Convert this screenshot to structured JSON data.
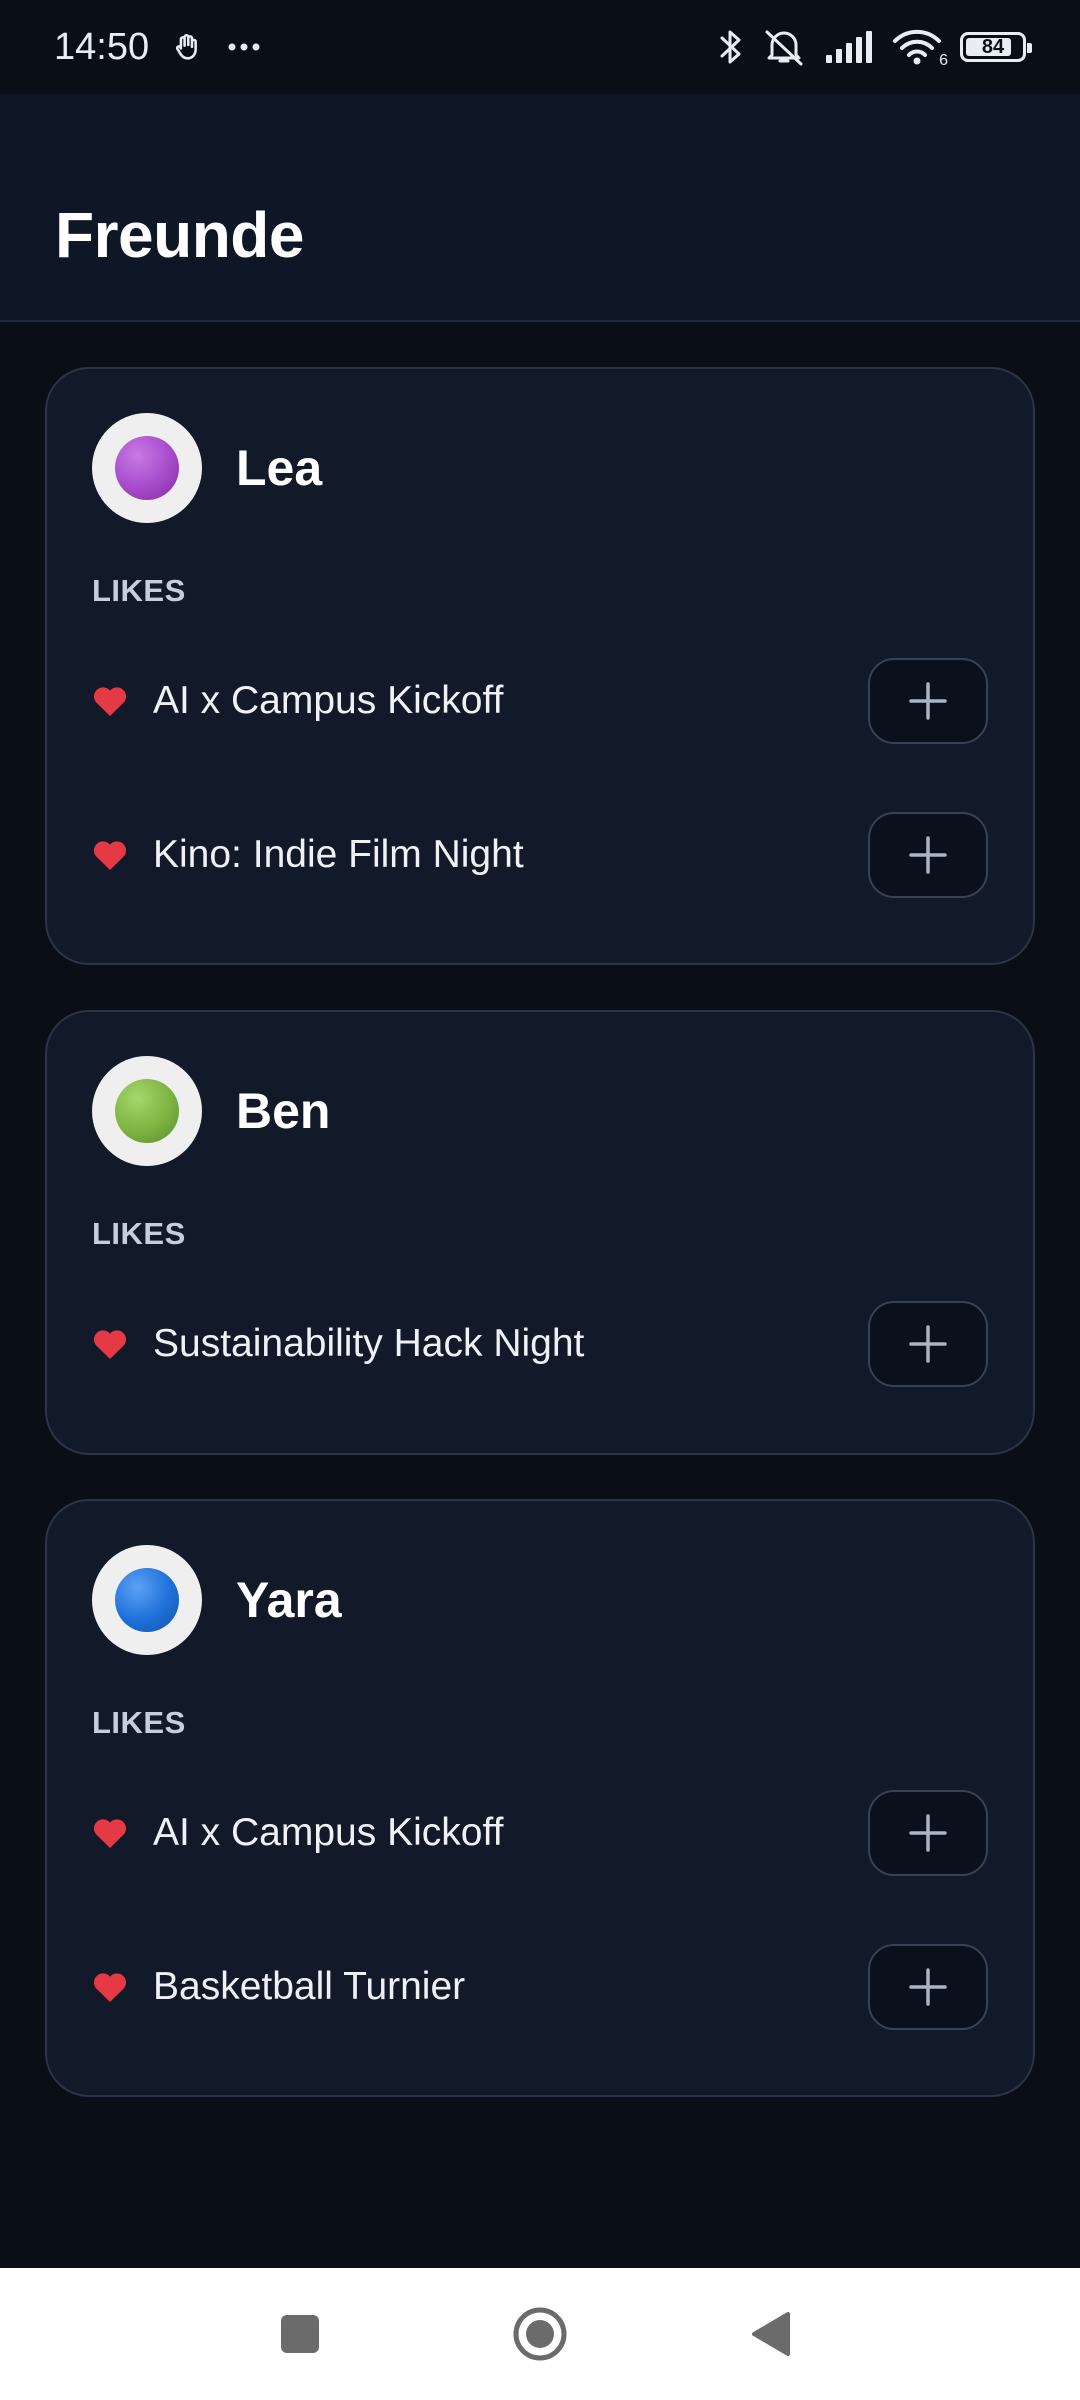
{
  "status_bar": {
    "time": "14:50",
    "notification_icons": [
      "hand-icon",
      "more-dots-icon"
    ],
    "system_icons": [
      "bluetooth-icon",
      "mute-icon",
      "signal-icon",
      "wifi-icon"
    ],
    "wifi_label": "6",
    "battery_level": "84",
    "battery_fraction": 0.84
  },
  "header": {
    "title": "Freunde"
  },
  "likes_label": "LIKES",
  "colors": {
    "heart": "#e63946",
    "lea_dot": "#a64ac9",
    "ben_dot": "#7cb342",
    "yara_dot": "#1e6fd9"
  },
  "friends": [
    {
      "name": "Lea",
      "avatar_icon": "purple-circle",
      "likes": [
        {
          "title": "AI x Campus Kickoff",
          "action": "+"
        },
        {
          "title": "Kino: Indie Film Night",
          "action": "+"
        }
      ]
    },
    {
      "name": "Ben",
      "avatar_icon": "green-circle",
      "likes": [
        {
          "title": "Sustainability Hack Night",
          "action": "+"
        }
      ]
    },
    {
      "name": "Yara",
      "avatar_icon": "blue-circle",
      "likes": [
        {
          "title": "AI x Campus Kickoff",
          "action": "+"
        },
        {
          "title": "Basketball Turnier",
          "action": "+"
        }
      ]
    }
  ],
  "nav": [
    "recents-icon",
    "home-icon",
    "back-icon"
  ]
}
